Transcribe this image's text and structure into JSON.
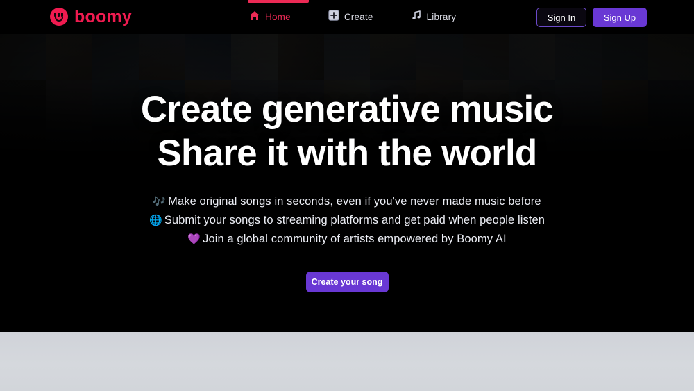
{
  "header": {
    "brand": {
      "name": "boomy",
      "logo_icon": "boomy-smiley-icon",
      "color": "#f01b50"
    },
    "nav": [
      {
        "label": "Home",
        "icon": "home-icon",
        "active": true
      },
      {
        "label": "Create",
        "icon": "plus-square-icon",
        "active": false
      },
      {
        "label": "Library",
        "icon": "music-note-icon",
        "active": false
      }
    ],
    "auth": {
      "sign_in_label": "Sign In",
      "sign_up_label": "Sign Up",
      "sign_in_border_color": "#6b49c8",
      "sign_up_bg_color": "#6938d4"
    }
  },
  "hero": {
    "headline_line1": "Create generative music",
    "headline_line2": "Share it with the world",
    "bullets": [
      {
        "emoji": "🎶",
        "emoji_name": "musical-notes-emoji",
        "text": "Make original songs in seconds, even if you've never made music before"
      },
      {
        "emoji": "🌐",
        "emoji_name": "globe-emoji",
        "text": "Submit your songs to streaming platforms and get paid when people listen"
      },
      {
        "emoji": "💜",
        "emoji_name": "purple-heart-emoji",
        "text": "Join a global community of artists empowered by Boomy AI"
      }
    ],
    "cta_label": "Create your song",
    "cta_color": "#6938d4",
    "background": "dark album-art collage fading to black"
  },
  "collage": {
    "tile_colors": [
      "#2a2a26",
      "#3b3a33",
      "#20262b",
      "#2c3138",
      "#1b2430",
      "#3a3b36",
      "#2e2a27",
      "#272c32",
      "#34322c",
      "#222a31",
      "#2b2622",
      "#3a3c3a",
      "#2c2f35",
      "#232a2e",
      "#313029",
      "#1d1c1a",
      "#2f2a2e",
      "#283038",
      "#1f2a33",
      "#353028",
      "#2a2d33",
      "#22252a",
      "#30332f",
      "#262b31",
      "#2d2823",
      "#343433",
      "#232930",
      "#2b3036",
      "#2f2b27",
      "#1c2026",
      "#262322",
      "#2d3139",
      "#1e2429",
      "#34302b",
      "#282d34",
      "#222226",
      "#2f3134",
      "#292621",
      "#30343a",
      "#252a30",
      "#2b2723",
      "#323532",
      "#1f252b",
      "#2c2e33",
      "#26221f",
      "#1a1a19",
      "#232529",
      "#2a2e34",
      "#1d2127",
      "#2e2b26",
      "#262a30",
      "#202327",
      "#2b2e32",
      "#24282e",
      "#2a2622",
      "#2e3030",
      "#21262c",
      "#282b30",
      "#2c2924",
      "#1b1f24"
    ]
  }
}
